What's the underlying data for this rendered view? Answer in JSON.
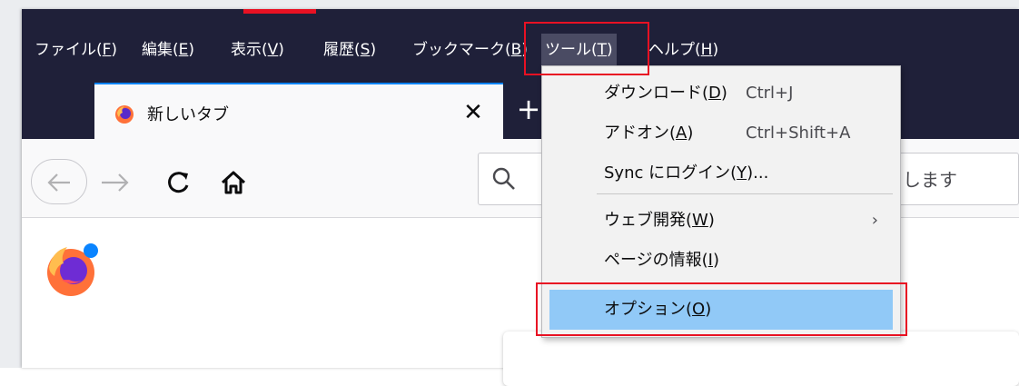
{
  "menubar": {
    "items": [
      {
        "pre": "ファイル(",
        "key": "F",
        "post": ")"
      },
      {
        "pre": "編集(",
        "key": "E",
        "post": ")"
      },
      {
        "pre": "表示(",
        "key": "V",
        "post": ")"
      },
      {
        "pre": "履歴(",
        "key": "S",
        "post": ")"
      },
      {
        "pre": "ブックマーク(",
        "key": "B",
        "post": ")"
      },
      {
        "pre": "ツール(",
        "key": "T",
        "post": ")"
      },
      {
        "pre": "ヘルプ(",
        "key": "H",
        "post": ")"
      }
    ],
    "active_index": 5
  },
  "tab": {
    "title": "新しいタブ",
    "close_glyph": "✕"
  },
  "new_tab_glyph": "+",
  "urlbar": {
    "placeholder_partial": "します"
  },
  "tools_menu": {
    "items": [
      {
        "pre": "ダウンロード(",
        "key": "D",
        "post": ")",
        "shortcut": "Ctrl+J"
      },
      {
        "pre": "アドオン(",
        "key": "A",
        "post": ")",
        "shortcut": "Ctrl+Shift+A"
      },
      {
        "pre": "Sync にログイン(",
        "key": "Y",
        "post": ")...",
        "shortcut": ""
      },
      {
        "pre": "ウェブ開発(",
        "key": "W",
        "post": ")",
        "shortcut": "",
        "submenu_glyph": "›"
      },
      {
        "pre": "ページの情報(",
        "key": "I",
        "post": ")",
        "shortcut": ""
      },
      {
        "pre": "オプション(",
        "key": "O",
        "post": ")",
        "shortcut": ""
      }
    ],
    "highlighted_index": 5
  },
  "colors": {
    "titlebar": "#1f2039",
    "highlight": "#91c9f7",
    "annotation": "#e81123",
    "accent": "#0a84ff"
  },
  "icons": [
    "firefox-logo-icon",
    "back-arrow-icon",
    "forward-arrow-icon",
    "reload-icon",
    "home-icon",
    "search-icon",
    "close-icon",
    "plus-icon",
    "chevron-right-icon"
  ]
}
